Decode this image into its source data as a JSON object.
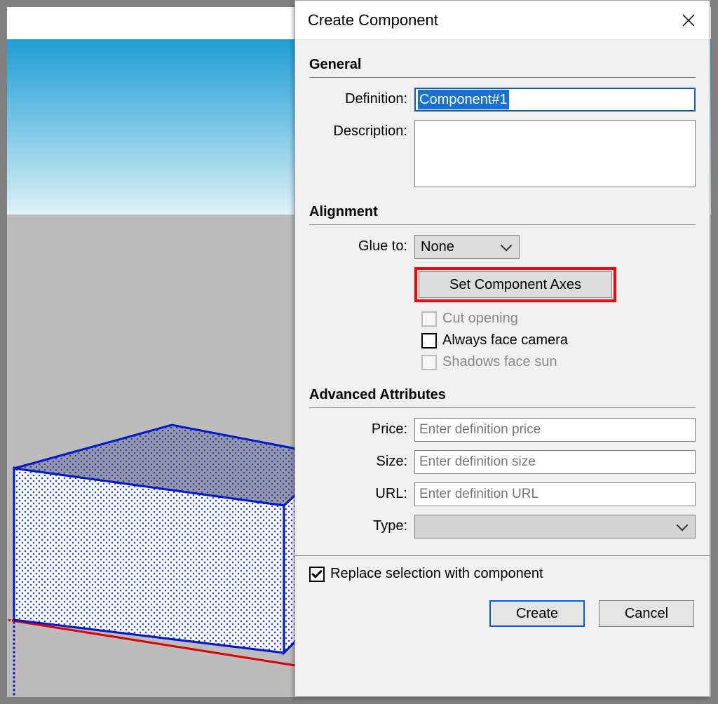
{
  "dialog": {
    "title": "Create Component",
    "sections": {
      "general": {
        "heading": "General",
        "definition_label": "Definition:",
        "definition_value": "Component#1",
        "description_label": "Description:",
        "description_value": ""
      },
      "alignment": {
        "heading": "Alignment",
        "glue_label": "Glue to:",
        "glue_value": "None",
        "axes_button": "Set Component Axes",
        "cut_opening_label": "Cut opening",
        "always_face_label": "Always face camera",
        "shadows_label": "Shadows face sun"
      },
      "advanced": {
        "heading": "Advanced Attributes",
        "price_label": "Price:",
        "price_placeholder": "Enter definition price",
        "size_label": "Size:",
        "size_placeholder": "Enter definition size",
        "url_label": "URL:",
        "url_placeholder": "Enter definition URL",
        "type_label": "Type:"
      }
    },
    "replace_label": "Replace selection with component",
    "create_button": "Create",
    "cancel_button": "Cancel"
  },
  "icons": {
    "close": "×",
    "chevron": "▾"
  },
  "colors": {
    "selection_blue": "#1a72ce",
    "highlight_red": "#ff0000",
    "axis_red": "#d80000",
    "axis_green": "#10b010",
    "axis_blue": "#0018c8"
  }
}
